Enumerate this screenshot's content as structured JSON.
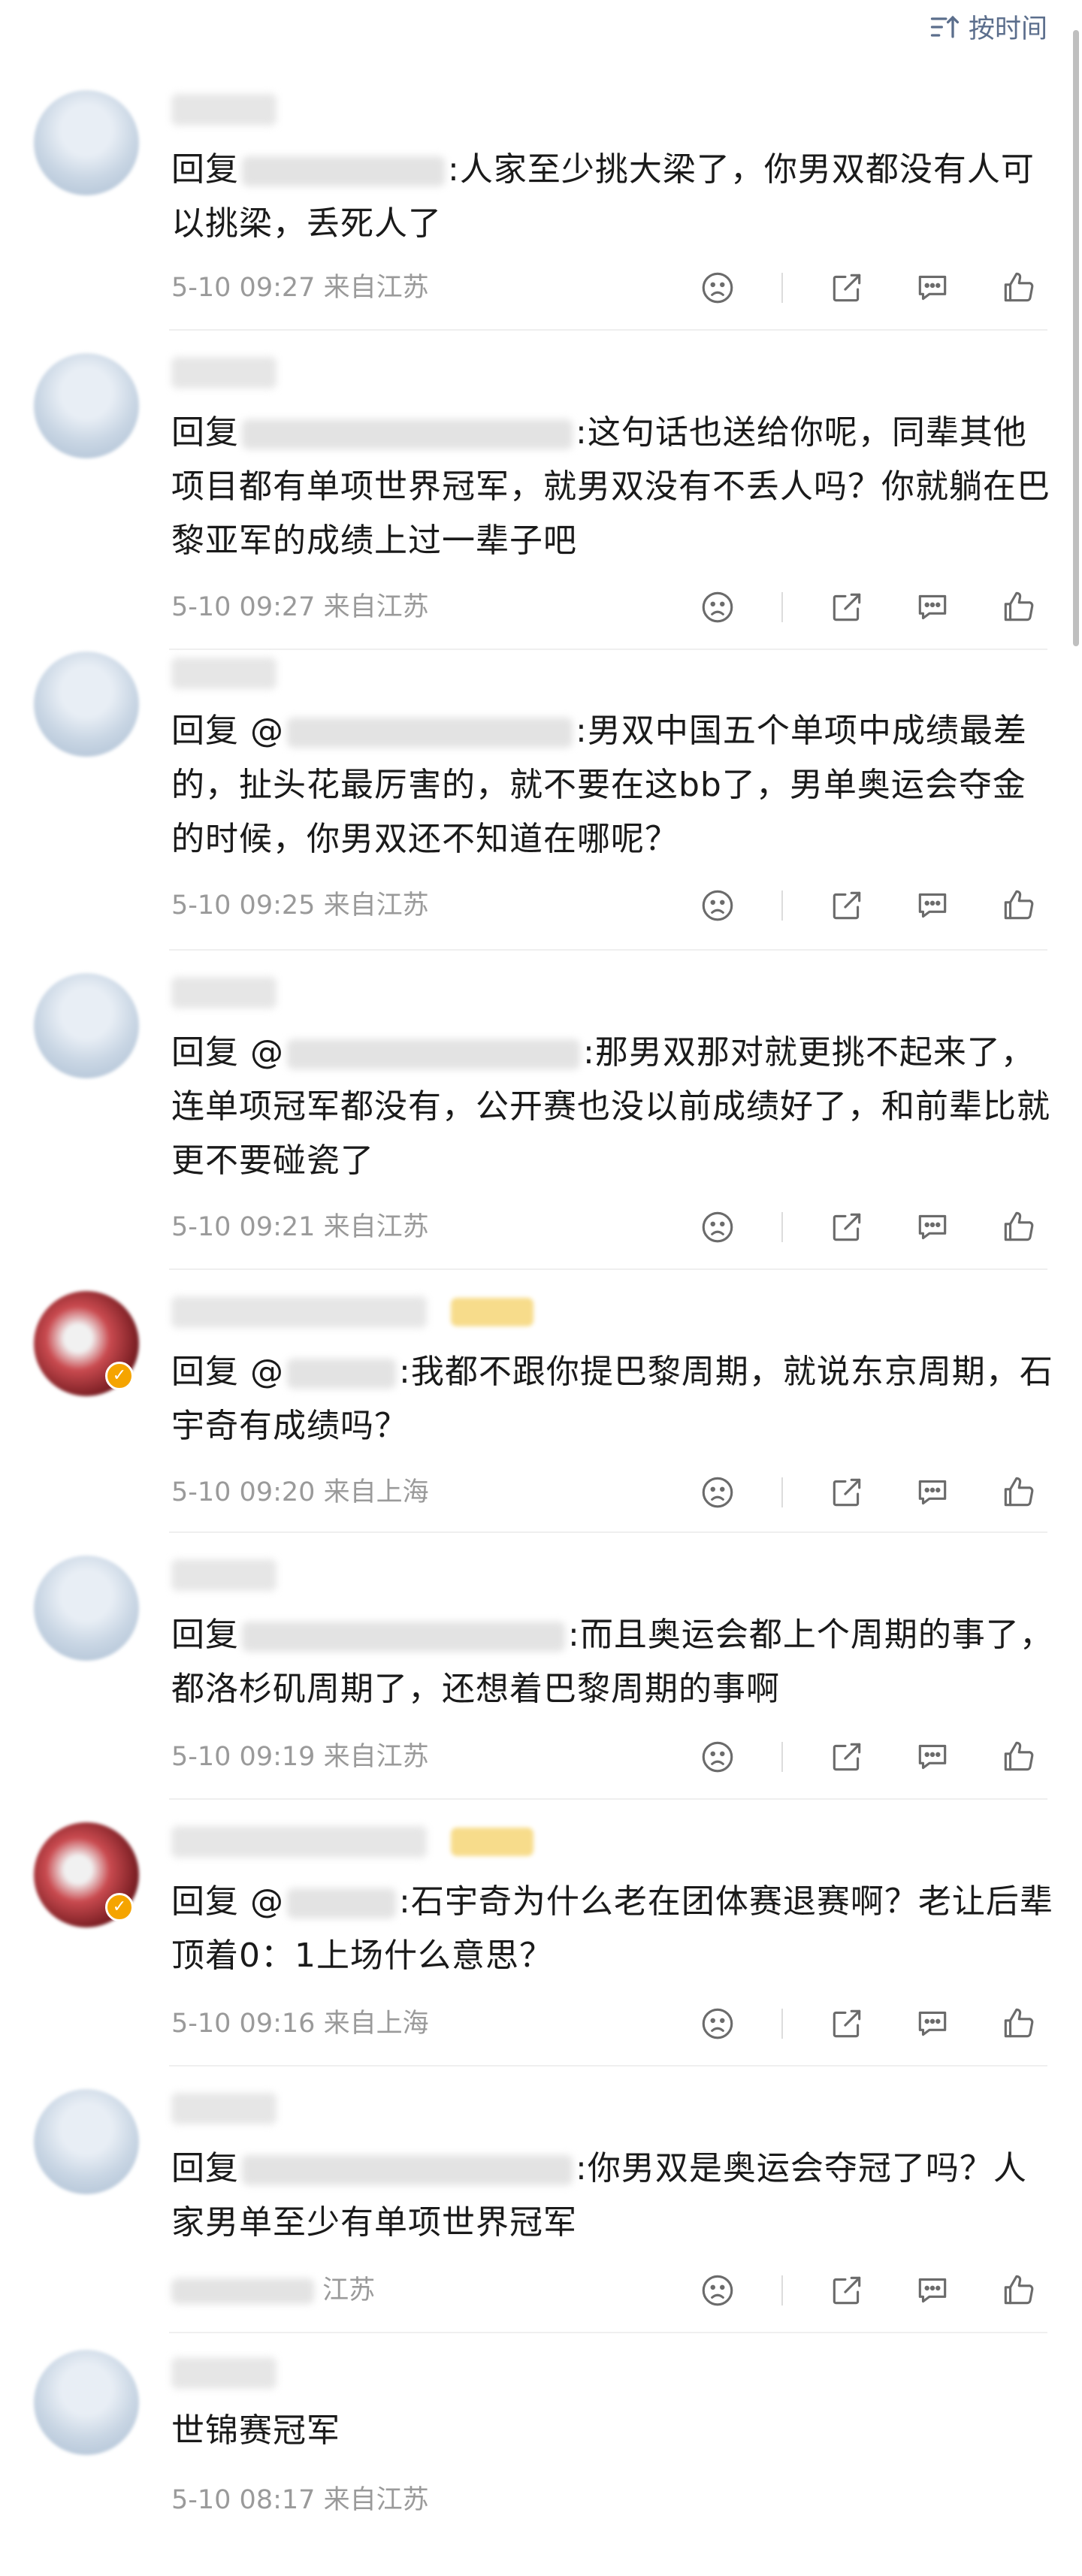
{
  "sort": {
    "label": "按时间"
  },
  "comments": [
    {
      "reply_prefix": "回复",
      "text": ":人家至少挑大梁了，你男双都没有人可以挑梁，丢死人了",
      "date": "5-10 09:27",
      "location": "来自江苏"
    },
    {
      "reply_prefix": "回复",
      "text": ":这句话也送给你呢，同辈其他项目都有单项世界冠军，就男双没有不丢人吗？你就躺在巴黎亚军的成绩上过一辈子吧",
      "date": "5-10 09:27",
      "location": "来自江苏"
    },
    {
      "reply_prefix": "回复 @",
      "text": ":男双中国五个单项中成绩最差的，扯头花最厉害的，就不要在这bb了，男单奥运会夺金的时候，你男双还不知道在哪呢？",
      "date": "5-10 09:25",
      "location": "来自江苏"
    },
    {
      "reply_prefix": "回复 @",
      "text": ":那男双那对就更挑不起来了，连单项冠军都没有，公开赛也没以前成绩好了，和前辈比就更不要碰瓷了",
      "date": "5-10 09:21",
      "location": "来自江苏"
    },
    {
      "reply_prefix": "回复 @",
      "text": ":我都不跟你提巴黎周期，就说东京周期，石宇奇有成绩吗？",
      "date": "5-10 09:20",
      "location": "来自上海"
    },
    {
      "reply_prefix": "回复",
      "text": ":而且奥运会都上个周期的事了，都洛杉矶周期了，还想着巴黎周期的事啊",
      "date": "5-10 09:19",
      "location": "来自江苏"
    },
    {
      "reply_prefix": "回复 @",
      "text": ":石宇奇为什么老在团体赛退赛啊？老让后辈顶着0：1上场什么意思？",
      "date": "5-10 09:16",
      "location": "来自上海"
    },
    {
      "reply_prefix": "回复",
      "text": ":你男双是奥运会夺冠了吗？人家男单至少有单项世界冠军",
      "date": "",
      "location": "江苏"
    },
    {
      "reply_prefix": "",
      "text": "世锦赛冠军",
      "date": "5-10 08:17",
      "location": "来自江苏"
    }
  ],
  "icons": [
    "sort-icon",
    "dislike-icon",
    "share-icon",
    "comment-icon",
    "like-icon"
  ]
}
